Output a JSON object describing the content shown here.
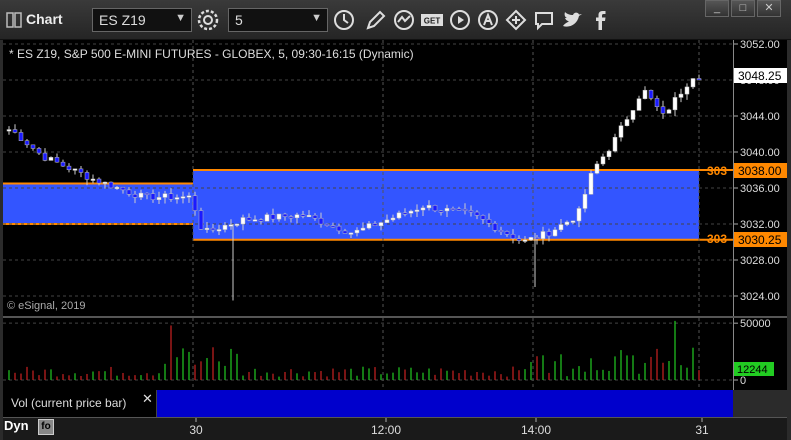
{
  "toolbar": {
    "title": "Chart",
    "symbol": "ES Z19",
    "interval": "5",
    "win_min": "_",
    "win_max": "□",
    "win_close": "✕"
  },
  "chart": {
    "header": "* ES Z19, S&P 500 E-MINI FUTURES - GLOBEX, 5, 09:30-16:15 (Dynamic)",
    "copyright": "© eSignal, 2019",
    "last_price": "3048.25",
    "level_upper": "3038.00",
    "level_lower": "3030.25",
    "level_upper_short": "303",
    "level_lower_short": "303",
    "accent_blue": "#3355ff",
    "level_orange": "#ff8800"
  },
  "volume": {
    "label": "Vol (current price bar)",
    "close": "✕",
    "last_value": "12244"
  },
  "footer": {
    "mode": "Dyn"
  },
  "chart_data": {
    "type": "candlestick",
    "price_axis": {
      "ticks": [
        "3052.00",
        "3048.00",
        "3044.00",
        "3040.00",
        "3036.00",
        "3032.00",
        "3028.00",
        "3024.00"
      ],
      "range": [
        3022,
        3052
      ]
    },
    "volume_axis": {
      "ticks": [
        "50000",
        "0"
      ],
      "range": [
        0,
        60000
      ]
    },
    "time_ticks": [
      "30",
      "12:00",
      "14:00",
      "31"
    ],
    "zones": [
      {
        "from": "start",
        "to": "30",
        "high": 3036.5,
        "low": 3032.0
      },
      {
        "from": "30",
        "to": "31",
        "high": 3038.0,
        "low": 3030.25
      }
    ]
  }
}
